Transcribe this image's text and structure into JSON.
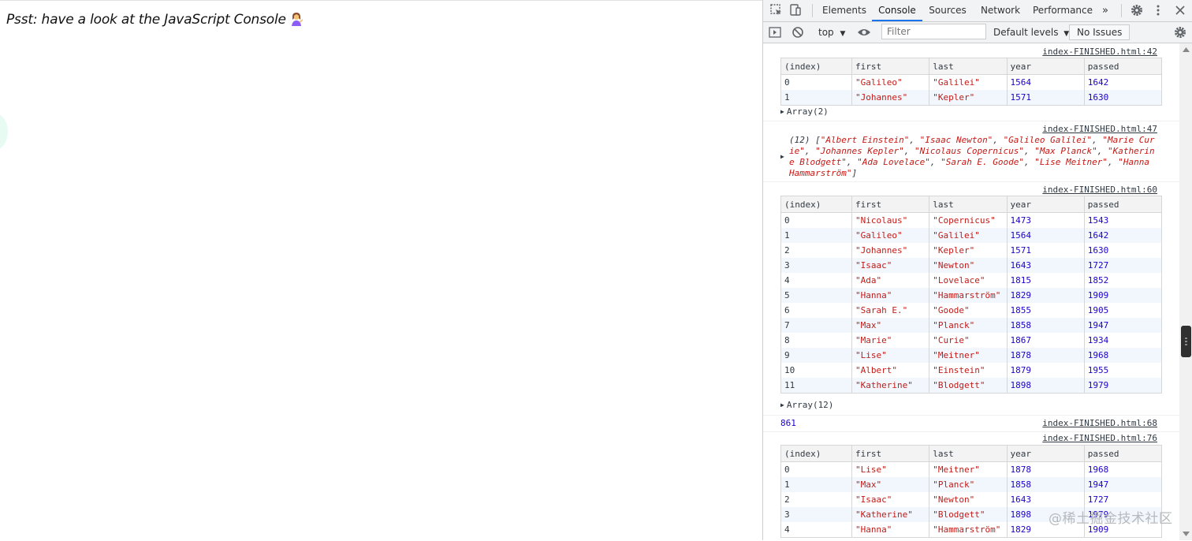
{
  "page": {
    "message": "Psst: have a look at the JavaScript Console"
  },
  "devtools": {
    "tabs": [
      "Elements",
      "Console",
      "Sources",
      "Network",
      "Performance"
    ],
    "more_tabs": "»",
    "toolbar": {
      "context": "top",
      "filter_placeholder": "Filter",
      "levels": "Default levels",
      "issues": "No Issues"
    }
  },
  "console": {
    "table_headers": [
      "(index)",
      "first",
      "last",
      "year",
      "passed"
    ],
    "msg1": {
      "source": "index-FINISHED.html:42",
      "rows": [
        [
          "0",
          "\"Galileo\"",
          "\"Galilei\"",
          "1564",
          "1642"
        ],
        [
          "1",
          "\"Johannes\"",
          "\"Kepler\"",
          "1571",
          "1630"
        ]
      ],
      "array_label": "Array(2)"
    },
    "msg2": {
      "source": "index-FINISHED.html:47",
      "text": "(12) [\"Albert Einstein\", \"Isaac Newton\", \"Galileo Galilei\", \"Marie Curie\", \"Johannes Kepler\", \"Nicolaus Copernicus\", \"Max Planck\", \"Katherine Blodgett\", \"Ada Lovelace\", \"Sarah E. Goode\", \"Lise Meitner\", \"Hanna Hammarström\"]"
    },
    "msg3": {
      "source": "index-FINISHED.html:60",
      "rows": [
        [
          "0",
          "\"Nicolaus\"",
          "\"Copernicus\"",
          "1473",
          "1543"
        ],
        [
          "1",
          "\"Galileo\"",
          "\"Galilei\"",
          "1564",
          "1642"
        ],
        [
          "2",
          "\"Johannes\"",
          "\"Kepler\"",
          "1571",
          "1630"
        ],
        [
          "3",
          "\"Isaac\"",
          "\"Newton\"",
          "1643",
          "1727"
        ],
        [
          "4",
          "\"Ada\"",
          "\"Lovelace\"",
          "1815",
          "1852"
        ],
        [
          "5",
          "\"Hanna\"",
          "\"Hammarström\"",
          "1829",
          "1909"
        ],
        [
          "6",
          "\"Sarah E.\"",
          "\"Goode\"",
          "1855",
          "1905"
        ],
        [
          "7",
          "\"Max\"",
          "\"Planck\"",
          "1858",
          "1947"
        ],
        [
          "8",
          "\"Marie\"",
          "\"Curie\"",
          "1867",
          "1934"
        ],
        [
          "9",
          "\"Lise\"",
          "\"Meitner\"",
          "1878",
          "1968"
        ],
        [
          "10",
          "\"Albert\"",
          "\"Einstein\"",
          "1879",
          "1955"
        ],
        [
          "11",
          "\"Katherine\"",
          "\"Blodgett\"",
          "1898",
          "1979"
        ]
      ],
      "array_label": "Array(12)"
    },
    "msg4": {
      "source": "index-FINISHED.html:68",
      "value": "861"
    },
    "msg5": {
      "source": "index-FINISHED.html:76",
      "rows": [
        [
          "0",
          "\"Lise\"",
          "\"Meitner\"",
          "1878",
          "1968"
        ],
        [
          "1",
          "\"Max\"",
          "\"Planck\"",
          "1858",
          "1947"
        ],
        [
          "2",
          "\"Isaac\"",
          "\"Newton\"",
          "1643",
          "1727"
        ],
        [
          "3",
          "\"Katherine\"",
          "\"Blodgett\"",
          "1898",
          "1979"
        ],
        [
          "4",
          "\"Hanna\"",
          "\"Hammarström\"",
          "1829",
          "1909"
        ]
      ]
    }
  },
  "watermark": "@稀土掘金技术社区"
}
